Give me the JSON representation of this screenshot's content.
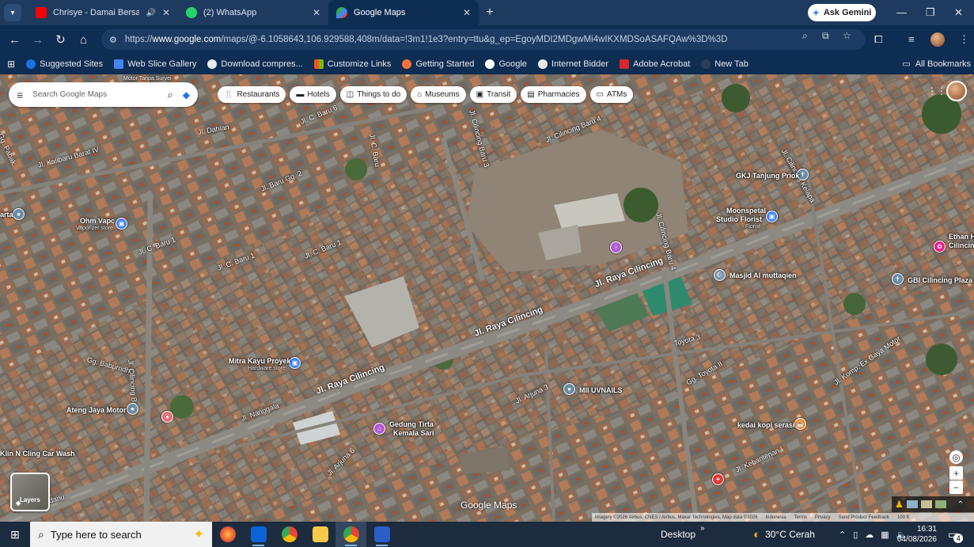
{
  "tabs": [
    {
      "title": "Chrisye - Damai Bersamamu",
      "favicon": "youtube-icon",
      "color": "#ff0000"
    },
    {
      "title": "(2) WhatsApp",
      "favicon": "whatsapp-icon",
      "color": "#25d366"
    },
    {
      "title": "Google Maps",
      "favicon": "google-maps-icon",
      "color": "#34a853"
    }
  ],
  "gemini_label": "Ask Gemini",
  "address": {
    "url_prefix": "https://",
    "url_host": "www.google.com",
    "url_path": "/maps/@-6.1058643,106.929588,408m/data=!3m1!1e3?entry=ttu&g_ep=EgoyMDI2MDgwMi4wIKXMDSoASAFQAw%3D%3D"
  },
  "bookmarks": [
    {
      "label": "Suggested Sites",
      "color": "#1a73e8"
    },
    {
      "label": "Web Slice Gallery",
      "color": "#4285f4"
    },
    {
      "label": "Download compres...",
      "color": "#e8eaed"
    },
    {
      "label": "Customize Links",
      "color": "#f4b400"
    },
    {
      "label": "Getting Started",
      "color": "#ff7139"
    },
    {
      "label": "Google",
      "color": "#4285f4"
    },
    {
      "label": "Internet Bidder",
      "color": "#e8eaed"
    },
    {
      "label": "Adobe Acrobat",
      "color": "#d7282f"
    },
    {
      "label": "New Tab",
      "color": "#2c3e55"
    }
  ],
  "all_bookmarks": "All Bookmarks",
  "search": {
    "placeholder": "Search Google Maps"
  },
  "chips": [
    "Restaurants",
    "Hotels",
    "Things to do",
    "Museums",
    "Transit",
    "Pharmacies",
    "ATMs"
  ],
  "map": {
    "labels": {
      "motor_tanpa_survei": "Motor Tanpa Survei",
      "gkj": "GKJ Tanjung Priok",
      "moonspetal": "Moonspetal",
      "moonspetal2": "Studio Florist",
      "moonspetal_sub": "Florist",
      "masjid": "Masjid Al muttaqien",
      "gbi": "GBI Cilincing Plaza",
      "ethan": "Ethan H",
      "ethan2": "Cilincing",
      "ohm": "Ohm Vapc",
      "ohm_sub": "Vaporizer store",
      "mitra": "Mitra Kayu Proyek",
      "mitra_sub": "Hardware store",
      "mii": "MII UVNAILS",
      "ateng": "Ateng Jaya Motor",
      "gedung": "Gedung Tirta",
      "gedung2": "Kemala Sari",
      "kedai": "kedai kopi serasi",
      "klin": "Klin N Cling Car Wash",
      "arta": "arta"
    },
    "streets": {
      "raya_cilincing_1": "Jl. Raya Cilincing",
      "raya_cilincing_2": "Jl. Raya Cilincing",
      "raya_cilincing_3": "Jl. Raya Cilincing",
      "kalibaru_barat": "Jl. Kalibaru Barat IV",
      "dahlan": "Jl. Dahlan",
      "cilincing_baru_4": "Jl. Cilincing Baru 4",
      "cilincing_baru_3": "Jl. Cilincing Baru 3",
      "c_baru_1a": "Jl. C. Baru 1",
      "c_baru_1b": "Jl. C. Baru 1",
      "c_baru_1c": "Jl. C. Baru 1",
      "c_baru_6": "Jl. C. Baru 6",
      "baru_gg2": "Jl. Baru Gg. 2",
      "c_baru": "Jl. C. Baru",
      "cilincing_kelapa": "Jl. Cilincing Kelapa",
      "cilincing_baru_4b": "Jl. Cilincing Baru 4",
      "nanggala": "Jl. Nanggala",
      "arjuna_3": "Jl. Arjuna 3",
      "arjuna_6": "Jl. Arjuna 6",
      "kebantenan": "Jl. Kebantenan I",
      "toyota_3": "Toyota 3",
      "gg_toyota": "Gg. Toyota II",
      "komp_ex": "Jl. Komp. Ex Gaya Motor",
      "wijayandanu": "Jl. Wijayandanu",
      "baburridho": "Gg. Baburridho",
      "cilincing_baru": "Jl. Cilincing Baru",
      "gg_pabak": "Gg. Pabak"
    },
    "layers_label": "Layers",
    "watermark": "Google Maps",
    "attribution": [
      "Imagery ©2026 Airbus, CNES / Airbus, Maxar Technologies, Map data ©2026",
      "Indonesia",
      "Terms",
      "Privacy",
      "Send Product Feedback",
      "100 ft"
    ]
  },
  "taskbar": {
    "search_placeholder": "Type here to search",
    "apps": [
      "firefox-icon",
      "outlook-icon",
      "chrome-icon",
      "file-explorer-icon",
      "chrome-active-icon",
      "word-icon"
    ],
    "desktop": "Desktop",
    "weather": "30°C  Cerah",
    "time": "16:31",
    "date": "04/08/2026",
    "notifications": "4"
  }
}
